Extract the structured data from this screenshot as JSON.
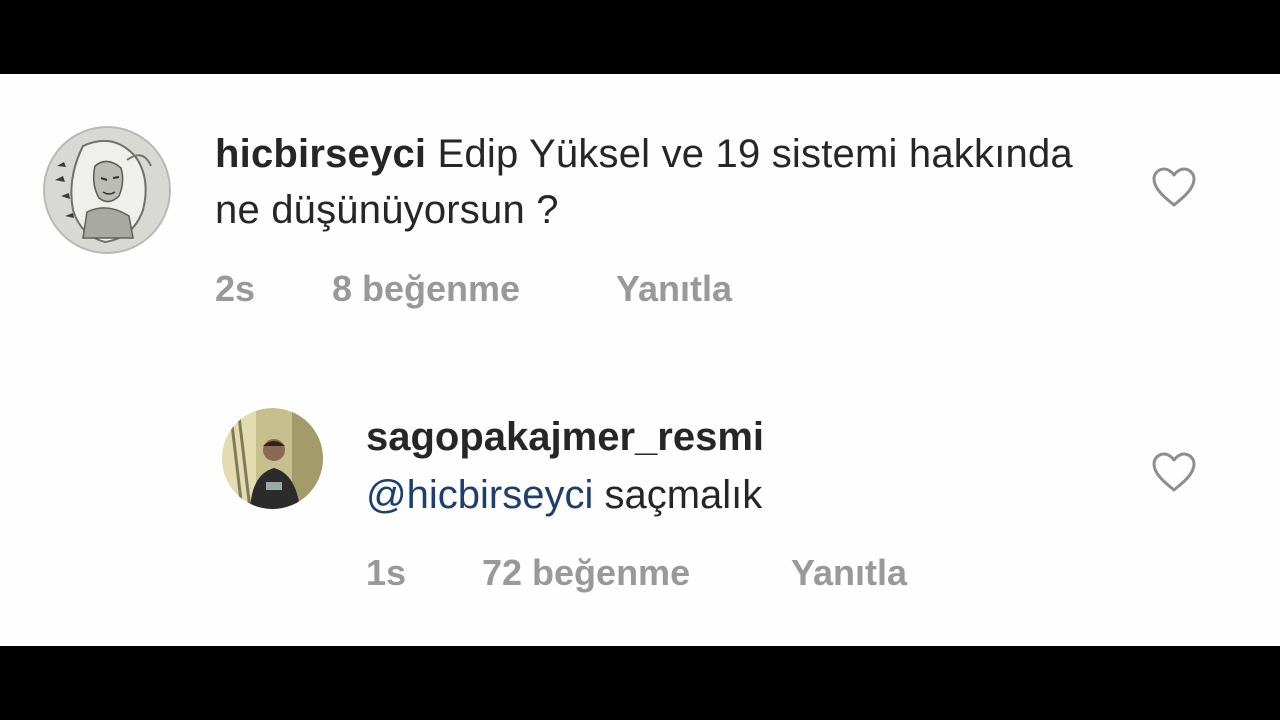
{
  "comments": [
    {
      "username": "hicbirseyci",
      "text": "Edip Yüksel ve 19 sistemi hakkında ne düşünüyorsun ?",
      "time": "2s",
      "likes": "8 beğenme",
      "reply_label": "Yanıtla",
      "like_icon": "heart-outline-icon"
    },
    {
      "username": "sagopakajmer_resmi",
      "mention": "@hicbirseyci",
      "text": "saçmalık",
      "time": "1s",
      "likes": "72 beğenme",
      "reply_label": "Yanıtla",
      "like_icon": "heart-outline-icon"
    }
  ],
  "colors": {
    "mention": "#1c3f70",
    "meta_text": "#999999",
    "primary_text": "#262626",
    "background": "#fefefe"
  }
}
